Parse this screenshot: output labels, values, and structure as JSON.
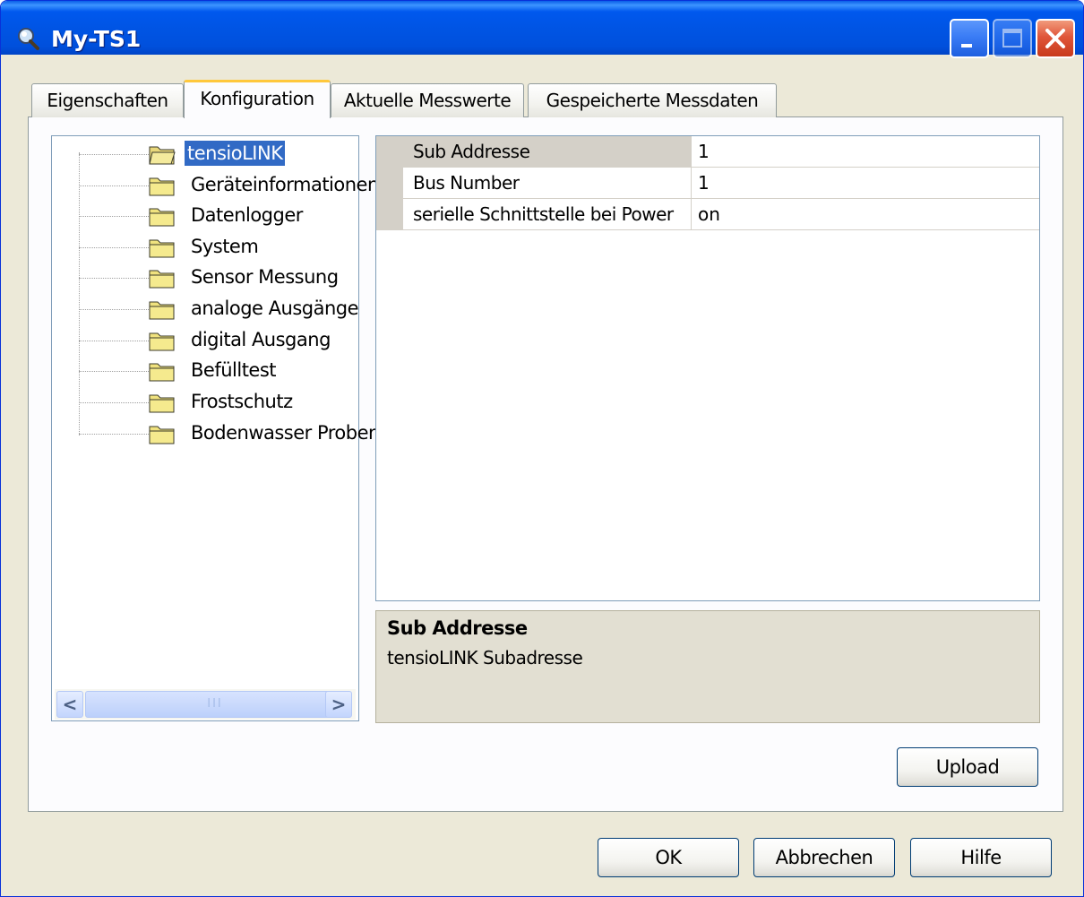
{
  "window": {
    "title": "My-TS1",
    "title_icon": "magnifier-icon"
  },
  "tabs": [
    {
      "label": "Eigenschaften",
      "active": false
    },
    {
      "label": "Konfiguration",
      "active": true
    },
    {
      "label": "Aktuelle Messwerte",
      "active": false
    },
    {
      "label": "Gespeicherte Messdaten",
      "active": false
    }
  ],
  "tree": {
    "items": [
      {
        "label": "tensioLINK",
        "icon": "folder-open-icon",
        "selected": true
      },
      {
        "label": "Geräteinformationen",
        "icon": "folder-icon",
        "selected": false
      },
      {
        "label": "Datenlogger",
        "icon": "folder-icon",
        "selected": false
      },
      {
        "label": "System",
        "icon": "folder-icon",
        "selected": false
      },
      {
        "label": "Sensor Messung",
        "icon": "folder-icon",
        "selected": false
      },
      {
        "label": "analoge Ausgänge",
        "icon": "folder-icon",
        "selected": false
      },
      {
        "label": "digital Ausgang",
        "icon": "folder-icon",
        "selected": false
      },
      {
        "label": "Befülltest",
        "icon": "folder-icon",
        "selected": false
      },
      {
        "label": "Frostschutz",
        "icon": "folder-icon",
        "selected": false
      },
      {
        "label": "Bodenwasser Probenah",
        "icon": "folder-icon",
        "selected": false
      }
    ],
    "scroll_left_glyph": "<",
    "scroll_right_glyph": ">",
    "scroll_grip": "III"
  },
  "properties": {
    "rows": [
      {
        "name": "Sub Addresse",
        "value": "1",
        "selected": true
      },
      {
        "name": "Bus Number",
        "value": "1",
        "selected": false
      },
      {
        "name": "serielle Schnittstelle bei Power",
        "value": "on",
        "selected": false
      }
    ]
  },
  "description": {
    "title": "Sub Addresse",
    "text": "tensioLINK Subadresse"
  },
  "buttons": {
    "upload": "Upload",
    "ok": "OK",
    "cancel": "Abbrechen",
    "help": "Hilfe"
  },
  "colors": {
    "titlebar": "#0054e3",
    "selection": "#316ac5",
    "dialog_bg": "#ece9d8",
    "active_tab_accent": "#ffc83c"
  }
}
